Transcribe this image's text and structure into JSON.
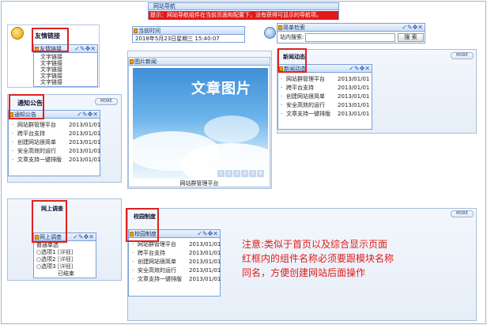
{
  "top_nav": {
    "title": "网站导航",
    "tip": "提示：网站导航组件在当前页面和配置下，没有获得可显示的导航项。"
  },
  "toolbar_icons": "✓✎✥✕",
  "friend_links": {
    "title": "友情链接",
    "inner_title": "友情链接",
    "links": [
      "文字链接",
      "文字链接",
      "文字链接",
      "文字链接",
      "文字链接"
    ]
  },
  "current_time": {
    "title": "当前时间",
    "value": "2018年5月23日星期三 15:40:07"
  },
  "simple_search": {
    "title": "简单检索",
    "label": "站内搜索:",
    "button": "搜 索"
  },
  "more_label": "MORE",
  "notice": {
    "title": "通知公告",
    "inner_title": "通知公告",
    "items": [
      {
        "text": "网站群管理平台",
        "date": "2013/01/01"
      },
      {
        "text": "跨平台支持",
        "date": "2013/01/01"
      },
      {
        "text": "创建网站很简单",
        "date": "2013/01/01"
      },
      {
        "text": "安全高效的运行",
        "date": "2013/01/01"
      },
      {
        "text": "文章支持一键排版",
        "date": "2013/01/01"
      }
    ]
  },
  "photo_news": {
    "title": "图片新闻",
    "image_text": "文章图片",
    "caption": "网站群管理平台",
    "pages": [
      "1",
      "2",
      "3",
      "4",
      "5",
      "6"
    ]
  },
  "news": {
    "title": "新闻动态",
    "inner_title": "新闻动态",
    "items": [
      {
        "text": "网站群管理平台",
        "date": "2013/01/01"
      },
      {
        "text": "跨平台支持",
        "date": "2013/01/01"
      },
      {
        "text": "创建网站很简单",
        "date": "2013/01/01"
      },
      {
        "text": "安全高效的运行",
        "date": "2013/01/01"
      },
      {
        "text": "文章支持一键排版",
        "date": "2013/01/01"
      }
    ]
  },
  "survey": {
    "title": "网上调查",
    "inner_title": "网上调查",
    "question": "普通单选",
    "options": [
      {
        "label": "选项1",
        "detail": "[详细]"
      },
      {
        "label": "选项2",
        "detail": "[详细]"
      },
      {
        "label": "选项3",
        "detail": "[详细]"
      }
    ],
    "status": "已结束"
  },
  "campus": {
    "title": "校园制度",
    "inner_title": "校园制度",
    "items": [
      {
        "text": "网站群管理平台",
        "date": "2013/01/01"
      },
      {
        "text": "跨平台支持",
        "date": "2013/01/01"
      },
      {
        "text": "创建网站很简单",
        "date": "2013/01/01"
      },
      {
        "text": "安全高效的运行",
        "date": "2013/01/01"
      },
      {
        "text": "文章支持一键排版",
        "date": "2013/01/01"
      }
    ]
  },
  "annotation_note": {
    "line1": "注意:类似于首页以及综合显示页面",
    "line2": "红框内的组件名称必须要跟模块名称",
    "line3": "同名，方便创建网站后面操作"
  }
}
